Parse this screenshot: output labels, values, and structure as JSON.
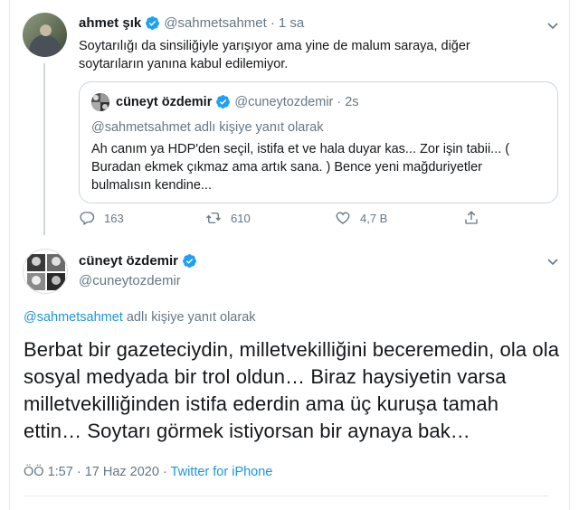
{
  "top_tweet": {
    "name": "ahmet şık",
    "handle": "@sahmetsahmet",
    "time": "1 sa",
    "text": "Soytarılığı da sinsiliğiyle yarışıyor ama yine de malum saraya, diğer soytarıların yanına kabul edilemiyor.",
    "quote": {
      "name": "cüneyt özdemir",
      "handle": "@cuneytozdemir",
      "time": "2s",
      "reply_to": "@sahmetsahmet adlı kişiye yanıt olarak",
      "text": "Ah canım ya HDP'den seçil, istifa et ve hala duyar kas... Zor işin tabii... ( Buradan ekmek çıkmaz ama artık sana. ) Bence yeni mağduriyetler bulmalısın kendine..."
    },
    "actions": {
      "replies": "163",
      "retweets": "610",
      "likes": "4,7 B"
    }
  },
  "main_tweet": {
    "name": "cüneyt özdemir",
    "handle": "@cuneytozdemir",
    "reply_mention": "@sahmetsahmet",
    "reply_suffix": " adlı kişiye yanıt olarak",
    "text": "Berbat bir gazeteciydin, milletvekilliğini beceremedin, ola ola sosyal medyada bir trol oldun… Biraz haysiyetin varsa milletvekilliğinden istifa ederdin ama üç kuruşa tamah ettin… Soytarı görmek istiyorsan bir aynaya bak…",
    "timestamp": "ÖÖ 1:57 · 17 Haz 2020 · ",
    "source": "Twitter for iPhone"
  },
  "colors": {
    "accent": "#1da1f2",
    "link": "#1b95e0",
    "muted": "#657786",
    "text": "#14171a",
    "border": "#ccd6dd"
  }
}
